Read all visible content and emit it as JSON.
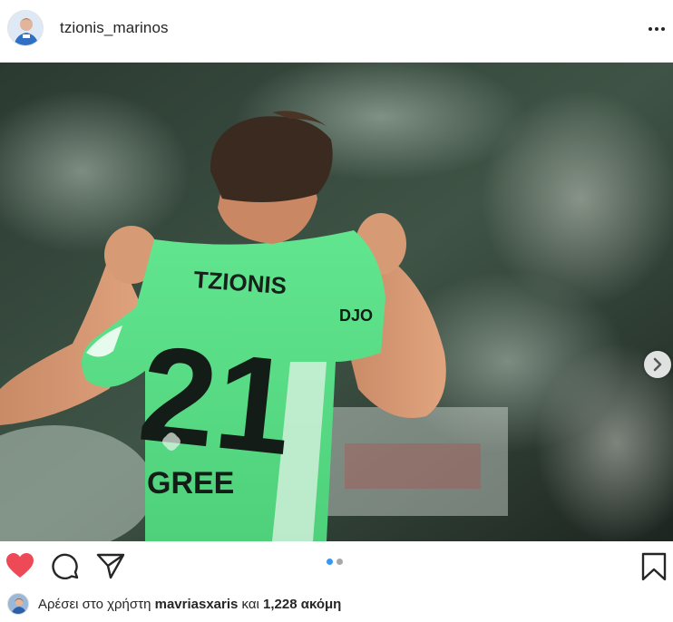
{
  "post": {
    "username": "tzionis_marinos",
    "photo": {
      "jersey_name": "TZIONIS",
      "jersey_number": "21",
      "sponsor": "GREE",
      "brand": "DJO"
    },
    "carousel": {
      "slides": 2,
      "active": 1
    }
  },
  "likes": {
    "prefix": "Αρέσει στο χρήστη",
    "user": "mavriasxaris",
    "middle": "και",
    "count_text": "1,228 ακόμη"
  },
  "colors": {
    "heart": "#ed4956",
    "accent": "#3897f0",
    "jersey": "#5ee08a"
  },
  "icons": [
    "heart-icon",
    "comment-icon",
    "share-icon",
    "bookmark-icon",
    "more-icon",
    "chevron-right-icon"
  ]
}
